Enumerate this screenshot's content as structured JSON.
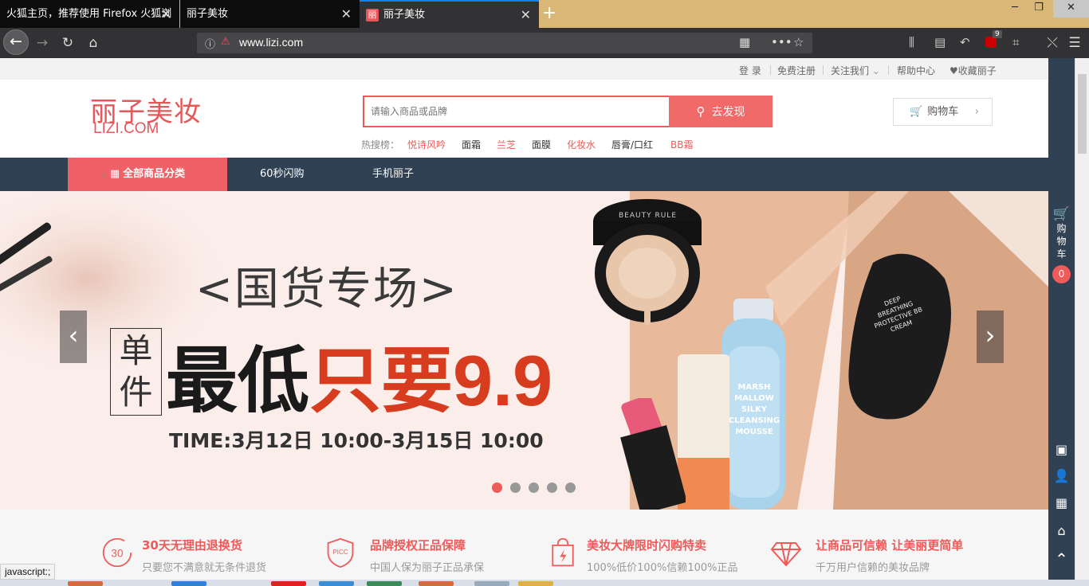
{
  "browser": {
    "tabs": [
      {
        "title": "火狐主页，推荐使用 Firefox 火狐浏",
        "active": false
      },
      {
        "title": "丽子美妆",
        "active": false
      },
      {
        "title": "丽子美妆",
        "active": true,
        "favicon": "丽"
      }
    ],
    "new_tab": "+",
    "url": "www.lizi.com",
    "ublock_count": "9",
    "status_text": "javascript:;"
  },
  "site": {
    "top_links": {
      "login": "登 录",
      "register": "免费注册",
      "follow": "关注我们",
      "help": "帮助中心",
      "favorite": "收藏丽子"
    },
    "logo_cn": "丽子美妆",
    "logo_en": "LIZI.COM",
    "search": {
      "placeholder": "请输入商品或品牌",
      "button": "去发现",
      "hot_label": "热搜榜：",
      "hot_words": [
        "悦诗风吟",
        "面霜",
        "兰芝",
        "面膜",
        "化妆水",
        "唇膏/口红",
        "BB霜"
      ]
    },
    "cart_label": "购物车",
    "nav": {
      "all_categories": "全部商品分类",
      "items": [
        "60秒闪购",
        "手机丽子"
      ]
    },
    "banner": {
      "title": "<国货专场>",
      "single": "单件",
      "price_prefix": "最低",
      "price_mid": "只要",
      "price": "9.9",
      "time": "TIME:3月12日 10:00-3月15日 10:00",
      "cushion_brand": "BEAUTY RULE",
      "spray_text": "MARSH MALLOW SILKY CLEANSING MOUSSE",
      "bb_text": "DEEP BREATHING PROTECTIVE BB CREAM",
      "slide_count": 5,
      "active_slide": 1
    },
    "features": [
      {
        "title": "30天无理由退换货",
        "sub": "只要您不满意就无条件退货",
        "icon": "30"
      },
      {
        "title": "品牌授权正品保障",
        "sub": "中国人保为丽子正品承保",
        "icon": "PICC"
      },
      {
        "title": "美妆大牌限时闪购特卖",
        "sub": "100%低价100%信赖100%正品",
        "icon": "bag"
      },
      {
        "title": "让商品可信赖 让美丽更简单",
        "sub": "千万用户信赖的美妆品牌",
        "icon": "diamond"
      }
    ],
    "sidebar": {
      "cart_label": "购物车",
      "cart_count": "0"
    }
  }
}
